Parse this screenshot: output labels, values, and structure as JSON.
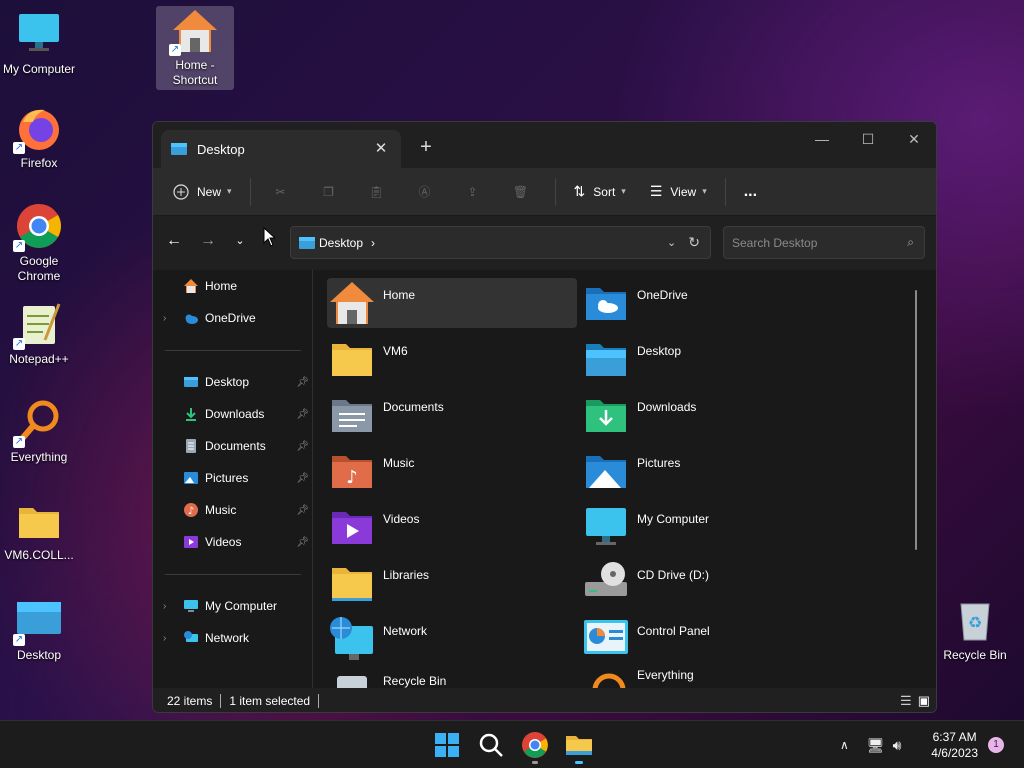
{
  "desktop": {
    "icons": [
      {
        "label": "My Computer"
      },
      {
        "label": "Home - Shortcut"
      },
      {
        "label": "Firefox"
      },
      {
        "label": "Google Chrome"
      },
      {
        "label": "Notepad++"
      },
      {
        "label": "Everything"
      },
      {
        "label": "VM6.COLL..."
      },
      {
        "label": "Desktop"
      },
      {
        "label": "Recycle Bin"
      }
    ]
  },
  "window": {
    "tab_title": "Desktop",
    "toolbar": {
      "new_label": "New",
      "sort_label": "Sort",
      "view_label": "View",
      "more_label": "..."
    },
    "address": {
      "path_label": "Desktop",
      "search_placeholder": "Search Desktop"
    },
    "sidebar": {
      "home": "Home",
      "onedrive": "OneDrive",
      "quick": [
        "Desktop",
        "Downloads",
        "Documents",
        "Pictures",
        "Music",
        "Videos"
      ],
      "my_computer": "My Computer",
      "network": "Network"
    },
    "items": [
      "Home",
      "OneDrive",
      "VM6",
      "Desktop",
      "Documents",
      "Downloads",
      "Music",
      "Pictures",
      "Videos",
      "My Computer",
      "Libraries",
      "CD Drive (D:)",
      "Network",
      "Control Panel",
      "Recycle Bin",
      "Everything"
    ],
    "status": {
      "count": "22 items",
      "selected": "1 item selected"
    }
  },
  "taskbar": {
    "time": "6:37 AM",
    "date": "4/6/2023",
    "notification_count": "1"
  },
  "colors": {
    "folder": "#f6c94c",
    "accent": "#4cc2ff"
  }
}
